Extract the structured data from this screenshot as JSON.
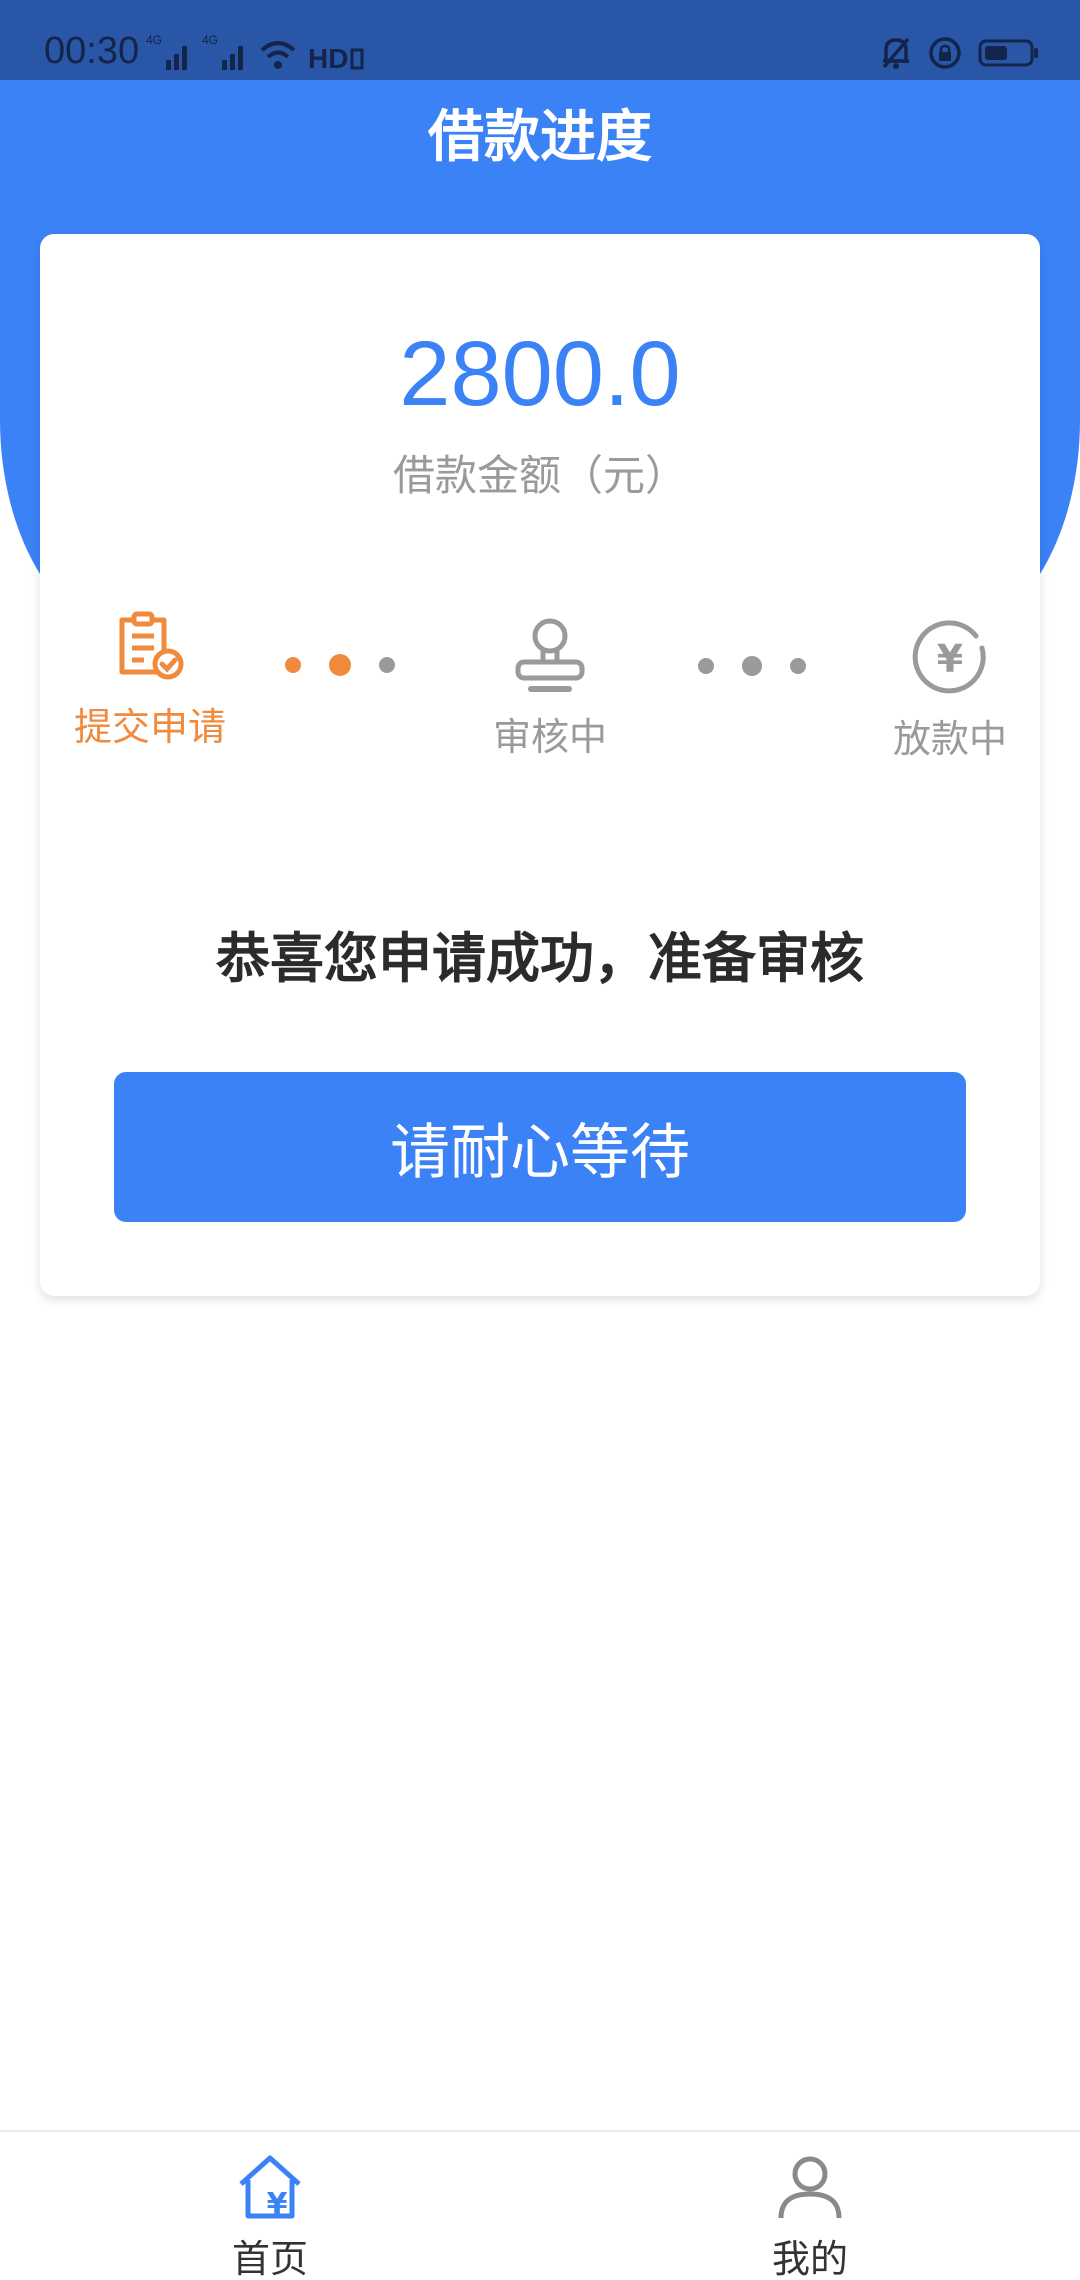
{
  "status_bar": {
    "time": "00:30",
    "network_1": "4G",
    "network_2": "4G",
    "hd_label": "HD"
  },
  "header": {
    "title": "借款进度"
  },
  "card": {
    "amount": "2800.0",
    "amount_label": "借款金额（元）",
    "steps": [
      {
        "label": "提交申请",
        "icon": "document-check-icon",
        "state": "done",
        "color": "#f08a3c"
      },
      {
        "label": "审核中",
        "icon": "stamp-icon",
        "state": "pending",
        "color": "#9a9a9a"
      },
      {
        "label": "放款中",
        "icon": "yuan-coin-icon",
        "state": "pending",
        "color": "#9a9a9a"
      }
    ],
    "message": "恭喜您申请成功，准备审核",
    "button_label": "请耐心等待"
  },
  "bottom_nav": {
    "items": [
      {
        "label": "首页",
        "icon": "home-yuan-icon",
        "active": true
      },
      {
        "label": "我的",
        "icon": "user-icon",
        "active": false
      }
    ]
  },
  "colors": {
    "primary": "#3c82f7",
    "accent": "#f08a3c",
    "status_bar": "#2a56a8",
    "muted": "#9a9a9a"
  }
}
